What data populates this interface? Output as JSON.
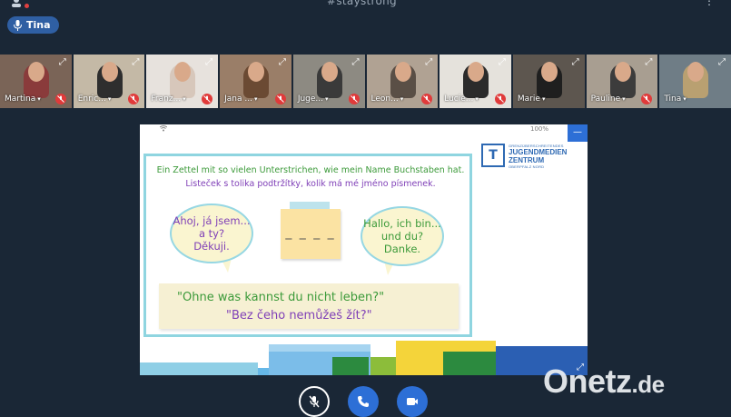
{
  "header": {
    "title": "#staystrong",
    "user_pill": {
      "label": "Tina",
      "icon": "microphone-icon"
    },
    "settings_icon": "users-icon",
    "menu_icon": "more-icon"
  },
  "participants": [
    {
      "name": "Martina",
      "muted": true,
      "bg": "#7a6457",
      "shirt": "#8a3b3b"
    },
    {
      "name": "Enric...",
      "muted": true,
      "bg": "#c4b9a6",
      "shirt": "#2e2e2e"
    },
    {
      "name": "Franz...",
      "muted": true,
      "bg": "#e7e2dd",
      "shirt": "#d7c7bb"
    },
    {
      "name": "Jana ...",
      "muted": true,
      "bg": "#9a7e68",
      "shirt": "#6b4a33"
    },
    {
      "name": "Juge...",
      "muted": true,
      "bg": "#8d8a82",
      "shirt": "#3a3a3a"
    },
    {
      "name": "Leon...",
      "muted": true,
      "bg": "#b0a293",
      "shirt": "#5a4f46"
    },
    {
      "name": "Lucie...",
      "muted": true,
      "bg": "#e5e2dc",
      "shirt": "#2b2b2b"
    },
    {
      "name": "Marie",
      "muted": false,
      "bg": "#5d564f",
      "shirt": "#1f1f1f"
    },
    {
      "name": "Pauline",
      "muted": true,
      "bg": "#a89e91",
      "shirt": "#3c3c3c"
    },
    {
      "name": "Tina",
      "muted": false,
      "bg": "#6f7d86",
      "shirt": "#b9a071"
    }
  ],
  "share": {
    "status_battery": "100%",
    "logo": {
      "small": "GRENZÜBERSCHREITENDES",
      "line1": "JUGENDMEDIEN",
      "line2": "ZENTRUM",
      "sub": "OBERPFALZ NORD"
    },
    "slide": {
      "line1": "Ein Zettel mit so vielen Unterstrichen, wie mein Name Buchstaben hat.",
      "line2": "Listeček s tolika podtržítky, kolik má mé jméno písmenek.",
      "bubble_left": [
        "Ahoj, já jsem...",
        "a ty?",
        "Děkuji."
      ],
      "bubble_right": [
        "Hallo, ich bin...",
        "und du?",
        "Danke."
      ],
      "note": "_ _ _ _",
      "quote_de": "\"Ohne was kannst du nicht leben?\"",
      "quote_cz": "\"Bez čeho nemůžeš žít?\""
    }
  },
  "controls": {
    "mic_icon": "mic-off-icon",
    "phone_icon": "phone-icon",
    "video_icon": "video-icon"
  },
  "watermark": {
    "brand": "Onetz",
    "suffix": ".de"
  },
  "colors": {
    "background": "#1a2736",
    "accent_blue": "#2d6fd6",
    "mute_red": "#e03a3a",
    "slide_green": "#3c9a3a",
    "slide_purple": "#7f3fb7"
  }
}
